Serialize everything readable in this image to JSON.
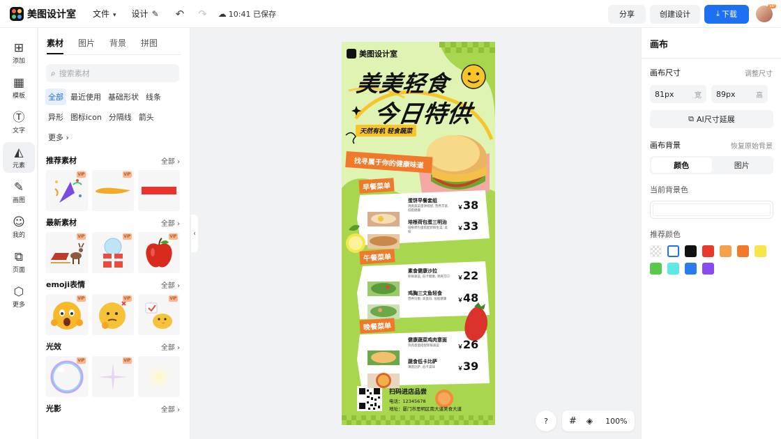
{
  "topbar": {
    "app_name": "美图设计室",
    "menu_file": "文件",
    "menu_design": "设计",
    "save_status": "10:41 已保存",
    "share_label": "分享",
    "create_label": "创建设计",
    "download_label": "下载",
    "avatar_badge": "VIP"
  },
  "leftnav": {
    "items": [
      {
        "label": "添加",
        "icon": "plus-square-icon"
      },
      {
        "label": "模板",
        "icon": "template-icon"
      },
      {
        "label": "文字",
        "icon": "text-icon"
      },
      {
        "label": "元素",
        "icon": "shapes-icon"
      },
      {
        "label": "画图",
        "icon": "pen-icon"
      },
      {
        "label": "我的",
        "icon": "user-icon"
      },
      {
        "label": "页面",
        "icon": "page-icon"
      },
      {
        "label": "更多",
        "icon": "cube-icon"
      }
    ]
  },
  "panel": {
    "tabs": [
      "素材",
      "图片",
      "背景",
      "拼图"
    ],
    "search_placeholder": "搜索素材",
    "chips": [
      "全部",
      "最近使用",
      "基础形状",
      "线条",
      "异形",
      "图标icon",
      "分隔线",
      "箭头",
      "更多"
    ],
    "sections": [
      {
        "title": "推荐素材",
        "all": "全部"
      },
      {
        "title": "最新素材",
        "all": "全部"
      },
      {
        "title": "emoji表情",
        "all": "全部"
      },
      {
        "title": "光效",
        "all": "全部"
      },
      {
        "title": "光影",
        "all": "全部"
      }
    ],
    "vip": "VIP"
  },
  "poster": {
    "brand": "美图设计室",
    "headline1": "美美轻食",
    "headline2": "今日特供",
    "tagline": "天然有机 轻食蔬菜",
    "banner": "找寻属于你的健康味道",
    "sections": [
      {
        "title": "早餐菜单",
        "items": [
          {
            "name": "蛋饼早餐套组",
            "desc": "清爽蔬菜蛋饼搭配, 营养丰富, 低脂健康",
            "price": "38"
          },
          {
            "name": "培根荷包蛋三明治",
            "desc": "培根荷包蛋搭配新鲜生菜, 美味",
            "price": "33"
          }
        ]
      },
      {
        "title": "午餐菜单",
        "items": [
          {
            "name": "素食健康沙拉",
            "desc": "新鲜蔬菜, 低卡健康, 清爽可口",
            "price": "22"
          },
          {
            "name": "鸡胸三文鱼轻食",
            "desc": "营养均衡, 高蛋白, 低脂健康",
            "price": "48"
          }
        ]
      },
      {
        "title": "晚餐菜单",
        "items": [
          {
            "name": "健康蔬菜鸡肉意面",
            "desc": "鸡肉意面搭配新鲜蔬菜",
            "price": "26"
          },
          {
            "name": "蔬食低卡比萨",
            "desc": "薄底比萨, 低卡美味",
            "price": "39"
          }
        ]
      }
    ],
    "qr_title": "扫码进店品尝",
    "phone": "电话：12345678",
    "address": "地址：厦门市思明区南大道美食大道",
    "currency": "￥"
  },
  "zoom": {
    "help": "?",
    "level": "100%"
  },
  "rightpanel": {
    "title": "画布",
    "size_label": "画布尺寸",
    "adjust_size": "调整尺寸",
    "width_value": "81px",
    "width_unit": "宽",
    "height_value": "89px",
    "height_unit": "高",
    "ai_extend": "AI尺寸延展",
    "bg_label": "画布背景",
    "restore_bg": "恢复原始背景",
    "bg_tab_color": "颜色",
    "bg_tab_image": "图片",
    "current_bg": "当前背景色",
    "recommended": "推荐颜色",
    "swatches": [
      "transparent",
      "#ffffff",
      "#111111",
      "#e8392a",
      "#f5a04b",
      "#f07a2a",
      "#f7e54a",
      "#5ac84a",
      "#5ee8e8",
      "#2b7bf0",
      "#8a4af0"
    ]
  }
}
